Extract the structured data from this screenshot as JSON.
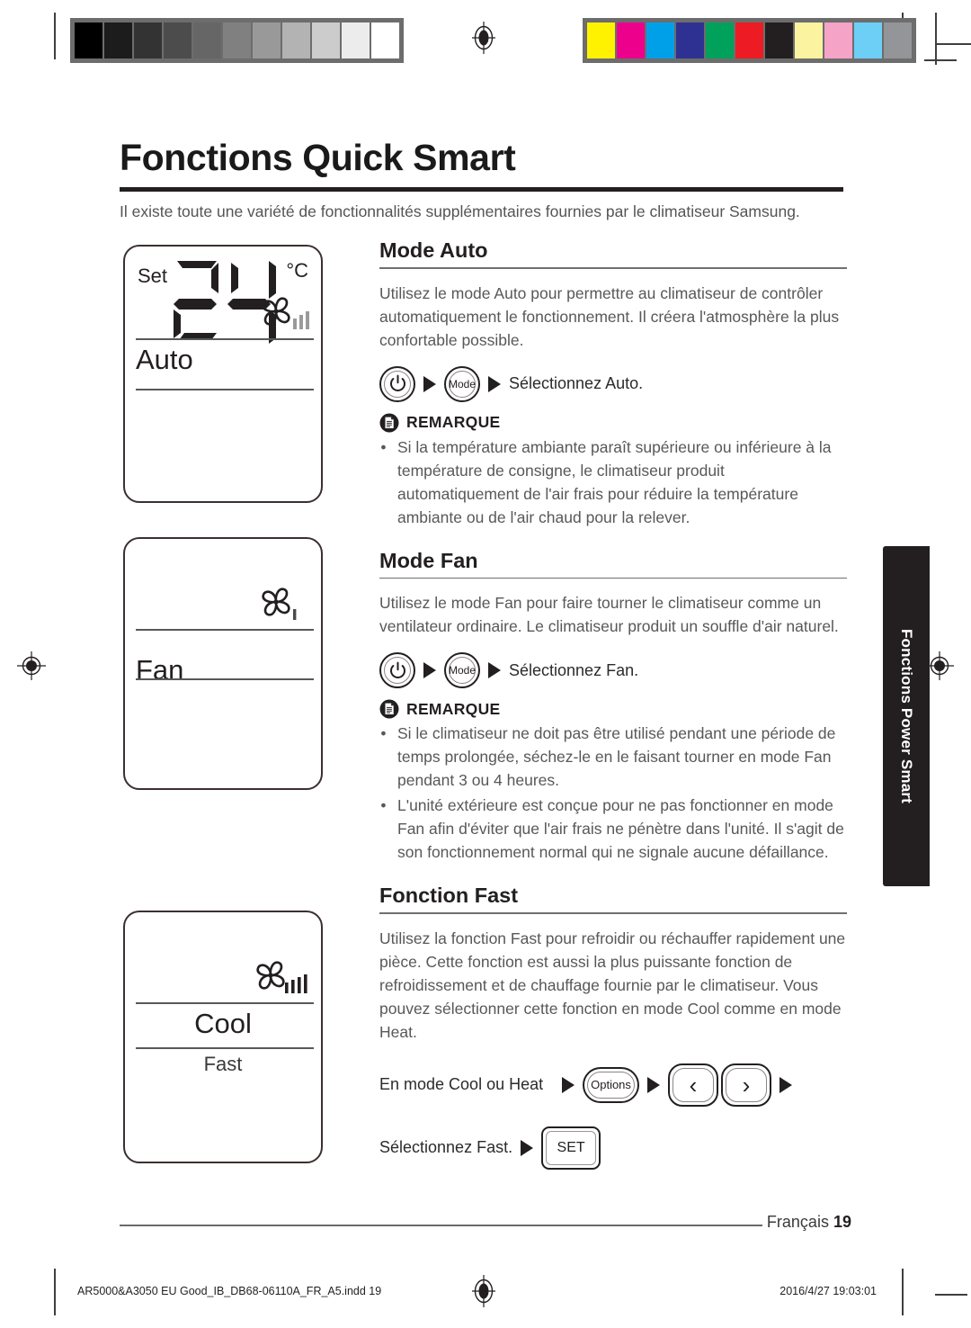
{
  "document": {
    "title": "Fonctions Quick Smart",
    "intro": "Il existe toute une variété de fonctionnalités supplémentaires fournies par le climatiseur Samsung.",
    "side_tab": "Fonctions Power Smart",
    "footer": {
      "language": "Français",
      "page_number": "19",
      "imprint_file": "AR5000&A3050 EU Good_IB_DB68-06110A_FR_A5.indd   19",
      "imprint_timestamp": "2016/4/27   19:03:01"
    }
  },
  "calibration": {
    "grayscale": [
      "#000000",
      "#1c1c1c",
      "#333333",
      "#4c4c4c",
      "#666666",
      "#808080",
      "#999999",
      "#b3b3b3",
      "#cccccc",
      "#ececec",
      "#ffffff"
    ],
    "color": [
      "#fff200",
      "#ec008c",
      "#00a0e9",
      "#2e3192",
      "#00a15a",
      "#ed1c24",
      "#231f20",
      "#fbf3a0",
      "#f5a3c7",
      "#6dcff6",
      "#939598"
    ],
    "frame_color": "#6d6d6d"
  },
  "lcd_panels": [
    {
      "name": "auto-display",
      "set_label": "Set",
      "temperature": "24",
      "unit": "°C",
      "fan_bars": 3,
      "mode_label": "Auto",
      "sub_label": ""
    },
    {
      "name": "fan-display",
      "set_label": "",
      "temperature": "",
      "unit": "",
      "fan_bars": 1,
      "mode_label": "Fan",
      "sub_label": ""
    },
    {
      "name": "cool-display",
      "set_label": "",
      "temperature": "",
      "unit": "",
      "fan_bars": 4,
      "mode_label": "Cool",
      "sub_label": "Fast"
    }
  ],
  "sections": [
    {
      "id": "mode-auto",
      "heading": "Mode Auto",
      "body": "Utilisez le mode Auto pour permettre au climatiseur de contrôler automatiquement le fonctionnement. Il créera l'atmosphère la plus confortable possible.",
      "steps": {
        "power_button": "power-icon",
        "mode_button": "Mode",
        "instruction": "Sélectionnez Auto."
      },
      "note": {
        "title": "REMARQUE",
        "items": [
          "Si la température ambiante paraît supérieure ou inférieure à la température de consigne, le climatiseur produit automatiquement de l'air frais pour réduire la température ambiante ou de l'air chaud pour la relever."
        ]
      }
    },
    {
      "id": "mode-fan",
      "heading": "Mode Fan",
      "body": "Utilisez le mode Fan pour faire tourner le climatiseur comme un ventilateur ordinaire. Le climatiseur produit un souffle d'air naturel.",
      "steps": {
        "power_button": "power-icon",
        "mode_button": "Mode",
        "instruction": "Sélectionnez Fan."
      },
      "note": {
        "title": "REMARQUE",
        "items": [
          "Si le climatiseur ne doit pas être utilisé pendant une période de temps prolongée, séchez-le en le faisant tourner en mode Fan pendant 3 ou 4 heures.",
          "L'unité extérieure est conçue pour ne pas fonctionner en mode Fan afin d'éviter que l'air frais ne pénètre dans l'unité. Il s'agit de son fonctionnement normal qui ne signale aucune défaillance."
        ]
      }
    },
    {
      "id": "fonction-fast",
      "heading": "Fonction Fast",
      "body": "Utilisez la fonction Fast pour refroidir ou réchauffer rapidement une pièce. Cette fonction est aussi la plus puissante fonction de refroidissement et de chauffage fournie par le climatiseur. Vous pouvez sélectionner cette fonction en mode Cool comme en mode Heat.",
      "fast_steps": {
        "line1_text": "En mode Cool ou Heat",
        "options_button": "Options",
        "left_chevron": "‹",
        "right_chevron": "›",
        "line2_text": "Sélectionnez Fast.",
        "set_button": "SET"
      }
    }
  ],
  "colors": {
    "ink": "#231f20",
    "body_text": "#58585b",
    "rule": "#6f6f72",
    "tab_bg": "#231f20"
  }
}
